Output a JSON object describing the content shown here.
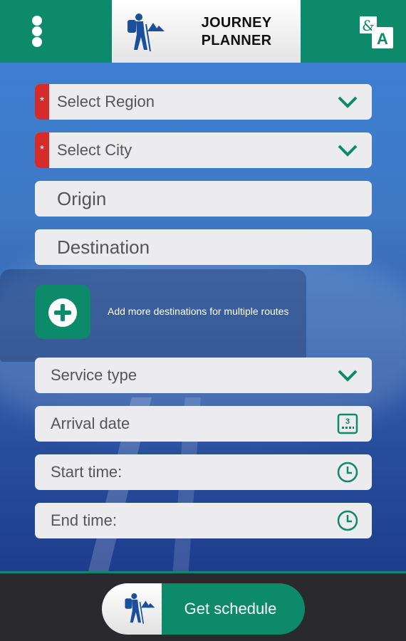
{
  "header": {
    "title_line1": "JOURNEY",
    "title_line2": "PLANNER",
    "menu_icon": "more-vertical-icon",
    "language_icon": "language-translate-icon",
    "logo_icon": "hiker-icon"
  },
  "form": {
    "region": {
      "placeholder": "Select Region",
      "required_marker": "*"
    },
    "city": {
      "placeholder": "Select City",
      "required_marker": "*"
    },
    "origin": {
      "placeholder": "Origin"
    },
    "destination": {
      "placeholder": "Destination"
    },
    "add_destinations_text": "Add more destinations for multiple routes",
    "service_type": {
      "placeholder": "Service type"
    },
    "arrival_date": {
      "placeholder": "Arrival date",
      "calendar_day": "3"
    },
    "start_time": {
      "placeholder": "Start time:"
    },
    "end_time": {
      "placeholder": "End time:"
    }
  },
  "footer": {
    "schedule_label": "Get schedule"
  },
  "colors": {
    "primary": "#0d8a6a",
    "required": "#d52b2b",
    "field_bg": "#ececef",
    "footer_bg": "#2a2a2e"
  }
}
